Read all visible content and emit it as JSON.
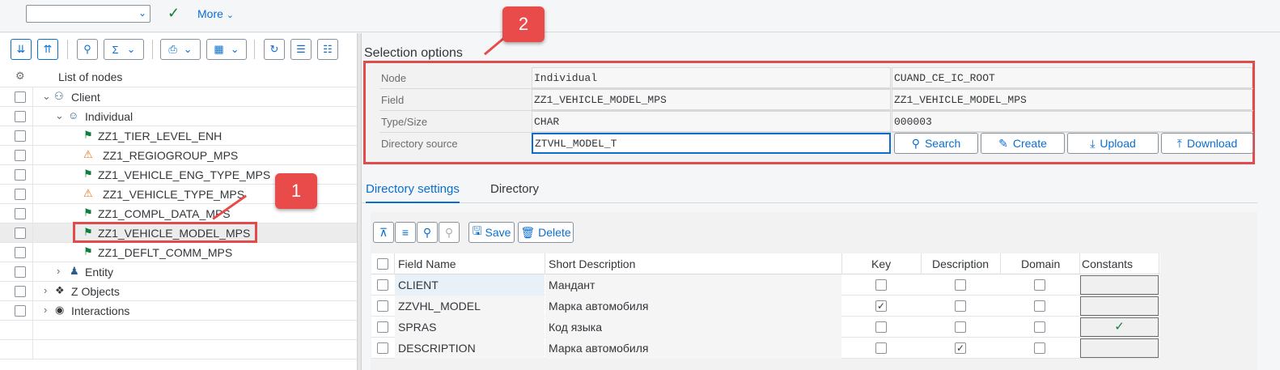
{
  "topbar": {
    "combo_value": "",
    "confirm_icon": "checkmark-icon",
    "more_label": "More"
  },
  "tree": {
    "header": "List of nodes",
    "nodes": [
      {
        "label": "Client",
        "icon": "group-icon",
        "expanded": true
      },
      {
        "label": "Individual",
        "icon": "person-circle-icon",
        "expanded": true
      },
      {
        "label": "ZZ1_TIER_LEVEL_ENH",
        "icon": "flag-icon"
      },
      {
        "label": "ZZ1_REGIOGROUP_MPS",
        "icon": "warning-icon"
      },
      {
        "label": "ZZ1_VEHICLE_ENG_TYPE_MPS",
        "icon": "flag-icon"
      },
      {
        "label": "ZZ1_VEHICLE_TYPE_MPS",
        "icon": "warning-icon"
      },
      {
        "label": "ZZ1_COMPL_DATA_MPS",
        "icon": "flag-icon"
      },
      {
        "label": "ZZ1_VEHICLE_MODEL_MPS",
        "icon": "flag-icon",
        "selected": true
      },
      {
        "label": "ZZ1_DEFLT_COMM_MPS",
        "icon": "flag-icon"
      },
      {
        "label": "Entity",
        "icon": "person-icon",
        "expanded": false
      },
      {
        "label": "Z Objects",
        "icon": "objects-icon",
        "expanded": false
      },
      {
        "label": "Interactions",
        "icon": "eye-icon",
        "expanded": false
      }
    ]
  },
  "callouts": {
    "one": "1",
    "two": "2"
  },
  "selection": {
    "title": "Selection options",
    "node_label": "Node",
    "node_value": "Individual",
    "node_value2": "CUAND_CE_IC_ROOT",
    "field_label": "Field",
    "field_value": "ZZ1_VEHICLE_MODEL_MPS",
    "field_value2": "ZZ1_VEHICLE_MODEL_MPS",
    "type_label": "Type/Size",
    "type_value": "CHAR",
    "size_value": "000003",
    "dirsrc_label": "Directory source",
    "dirsrc_value": "ZTVHL_MODEL_T",
    "search_label": "Search",
    "create_label": "Create",
    "upload_label": "Upload",
    "download_label": "Download"
  },
  "tabs": {
    "settings": "Directory settings",
    "directory": "Directory"
  },
  "dirtoolbar": {
    "save_label": "Save",
    "delete_label": "Delete"
  },
  "grid": {
    "headers": [
      "Field Name",
      "Short Description",
      "Key",
      "Description",
      "Domain",
      "Constants"
    ],
    "rows": [
      {
        "field": "CLIENT",
        "desc": "Мандант",
        "key": false,
        "description": false,
        "domain": false,
        "constant": false
      },
      {
        "field": "ZZVHL_MODEL",
        "desc": "Марка автомобиля",
        "key": true,
        "description": false,
        "domain": false,
        "constant": false
      },
      {
        "field": "SPRAS",
        "desc": "Код языка",
        "key": false,
        "description": false,
        "domain": false,
        "constant": true
      },
      {
        "field": "DESCRIPTION",
        "desc": "Марка автомобиля",
        "key": false,
        "description": true,
        "domain": false,
        "constant": false
      }
    ]
  },
  "colors": {
    "accent": "#0a6ed1",
    "highlight": "#e04c4c",
    "flag": "#107e3e",
    "warning": "#e9730c"
  }
}
